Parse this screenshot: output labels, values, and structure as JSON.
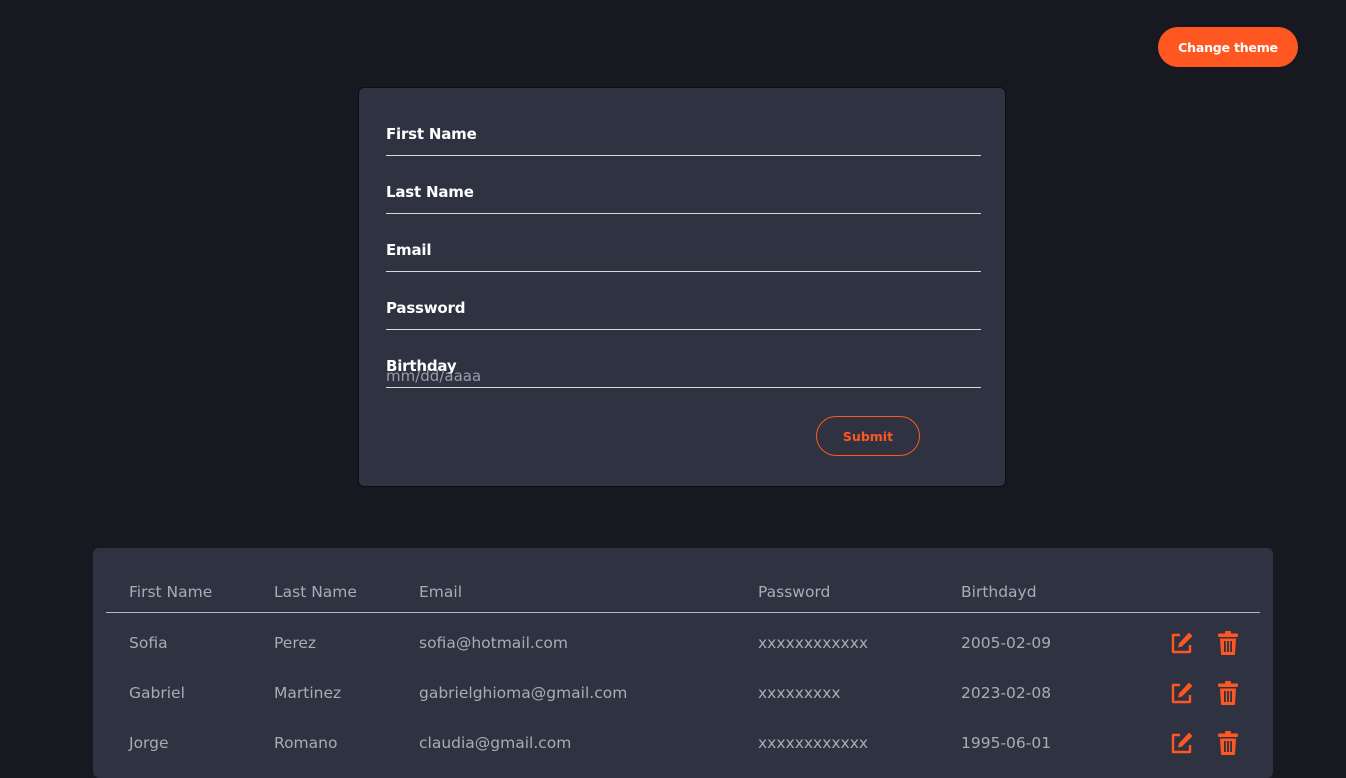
{
  "header": {
    "theme_button_label": "Change theme"
  },
  "form": {
    "fields": [
      {
        "label": "First Name",
        "value": "",
        "placeholder": ""
      },
      {
        "label": "Last Name",
        "value": "",
        "placeholder": ""
      },
      {
        "label": "Email",
        "value": "",
        "placeholder": ""
      },
      {
        "label": "Password",
        "value": "",
        "placeholder": ""
      },
      {
        "label": "Birthday",
        "value": "",
        "placeholder": "mm/dd/aaaa"
      }
    ],
    "submit_label": "Submit"
  },
  "table": {
    "headers": [
      "First Name",
      "Last Name",
      "Email",
      "Password",
      "Birthdayd"
    ],
    "rows": [
      {
        "first_name": "Sofia",
        "last_name": "Perez",
        "email": "sofia@hotmail.com",
        "password": "xxxxxxxxxxxx",
        "birthday": "2005-02-09"
      },
      {
        "first_name": "Gabriel",
        "last_name": "Martinez",
        "email": "gabrielghioma@gmail.com",
        "password": "xxxxxxxxx",
        "birthday": "2023-02-08"
      },
      {
        "first_name": "Jorge",
        "last_name": "Romano",
        "email": "claudia@gmail.com",
        "password": "xxxxxxxxxxxx",
        "birthday": "1995-06-01"
      }
    ],
    "row_actions": {
      "edit_icon": "edit-icon",
      "delete_icon": "trash-icon"
    }
  },
  "colors": {
    "accent": "#ff5722",
    "background": "#181821",
    "card": "#2f3241",
    "muted_text": "#a9abb7"
  }
}
